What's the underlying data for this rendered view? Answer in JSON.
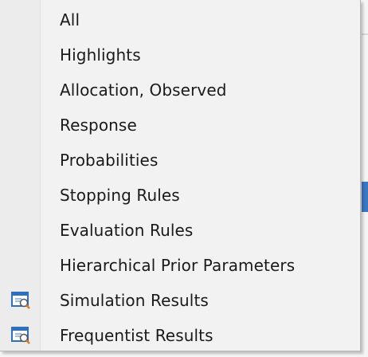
{
  "menu": {
    "items": [
      {
        "label": "All",
        "icon": null
      },
      {
        "label": "Highlights",
        "icon": null
      },
      {
        "label": "Allocation, Observed",
        "icon": null
      },
      {
        "label": "Response",
        "icon": null
      },
      {
        "label": "Probabilities",
        "icon": null
      },
      {
        "label": "Stopping Rules",
        "icon": null
      },
      {
        "label": "Evaluation Rules",
        "icon": null
      },
      {
        "label": "Hierarchical Prior Parameters",
        "icon": null
      },
      {
        "label": "Simulation Results",
        "icon": "results-window-icon"
      },
      {
        "label": "Frequentist Results",
        "icon": "results-window-icon"
      }
    ]
  },
  "colors": {
    "menu_background": "#f2f2f2",
    "text": "#1a1a1a",
    "icon_blue": "#2f6fc0",
    "icon_orange": "#e07a1f"
  }
}
